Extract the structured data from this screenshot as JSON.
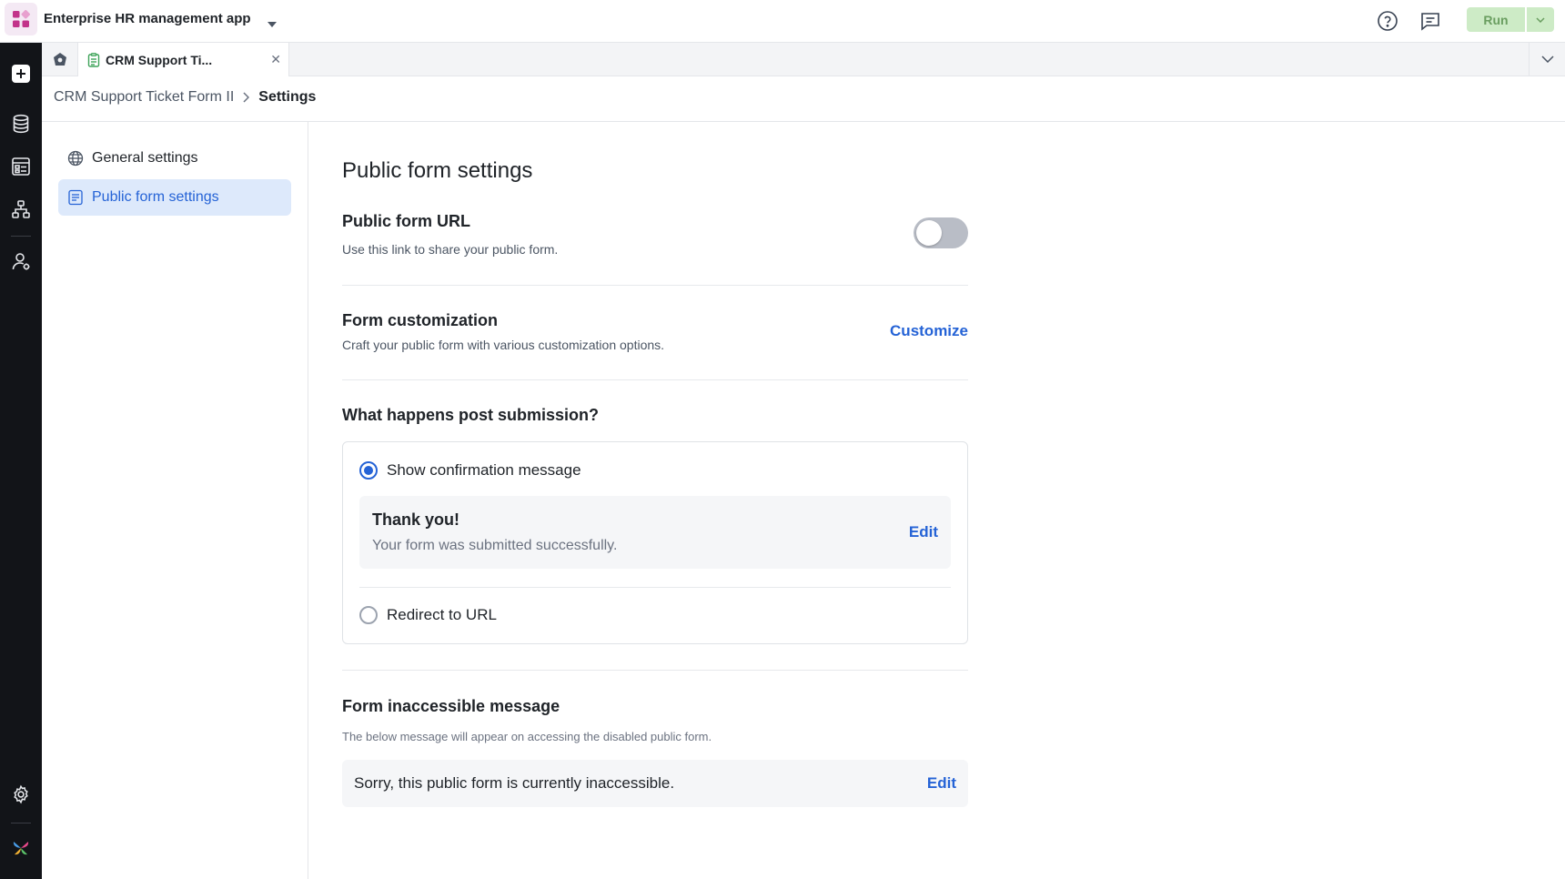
{
  "app": {
    "name": "Enterprise HR management app",
    "run_label": "Run"
  },
  "tabs": [
    {
      "label": "CRM Support Ti..."
    }
  ],
  "breadcrumb": {
    "parent": "CRM Support Ticket Form II",
    "current": "Settings"
  },
  "settings_nav": {
    "items": [
      {
        "label": "General settings",
        "icon": "globe-icon"
      },
      {
        "label": "Public form settings",
        "icon": "form-icon",
        "active": true
      }
    ]
  },
  "main": {
    "title": "Public form settings",
    "public_url": {
      "title": "Public form URL",
      "description": "Use this link to share your public form.",
      "enabled": false
    },
    "customization": {
      "title": "Form customization",
      "description": "Craft your public form with various customization options.",
      "action_label": "Customize"
    },
    "post_submission": {
      "title": "What happens post submission?",
      "options": [
        {
          "label": "Show confirmation message",
          "selected": true
        },
        {
          "label": "Redirect to URL",
          "selected": false
        }
      ],
      "confirmation": {
        "title": "Thank you!",
        "message": "Your form was submitted successfully.",
        "edit_label": "Edit"
      }
    },
    "inaccessible": {
      "title": "Form inaccessible message",
      "description": "The below message will appear on accessing the disabled public form.",
      "message": "Sorry, this public form is currently inaccessible.",
      "edit_label": "Edit"
    }
  },
  "colors": {
    "accent": "#2563d6",
    "rail": "#121418",
    "run_bg": "#cdebc6",
    "nav_active_bg": "#dde9fb"
  }
}
